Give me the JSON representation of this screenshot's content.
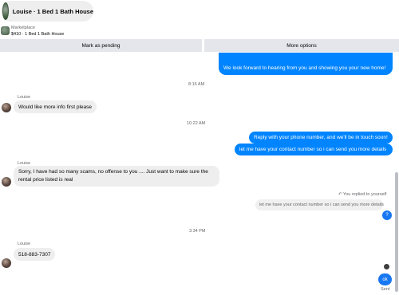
{
  "header": {
    "title": "Louise · 1 Bed 1 Bath House"
  },
  "marketplace": {
    "label": "Marketplace",
    "listing": "$410 · 1 Bed 1 Bath House"
  },
  "actions": {
    "pending": "Mark as pending",
    "more": "More options"
  },
  "messages": {
    "top_out": "We look forward to hearing from you and showing you your new home!",
    "time_1": "8:16 AM",
    "sender_1": "Louise",
    "in_1": "Would like more info first please",
    "time_2": "10:22 AM",
    "out_1": "Reply with your phone number, and we'll be in touch soon!",
    "out_2": "let me have your contact number so i can send you more details",
    "sender_2": "Louise",
    "in_2": "Sorry, I have had so many scams, no offense to you .... Just want to make sure the rental price listed is real",
    "replied_label": "You replied to yourself",
    "quoted": "let me have your contact number so i can send you more details",
    "q_mark": "?",
    "time_3": "3:34 PM",
    "sender_3": "Louise",
    "in_3": "518-883-7307",
    "ok": "ok",
    "sent": "Sent"
  },
  "colors": {
    "accent": "#0084ff",
    "bubble_in": "#eeeeee",
    "button_bg": "#e4e6eb"
  },
  "icons": {
    "reply": "reply-arrow-icon"
  }
}
